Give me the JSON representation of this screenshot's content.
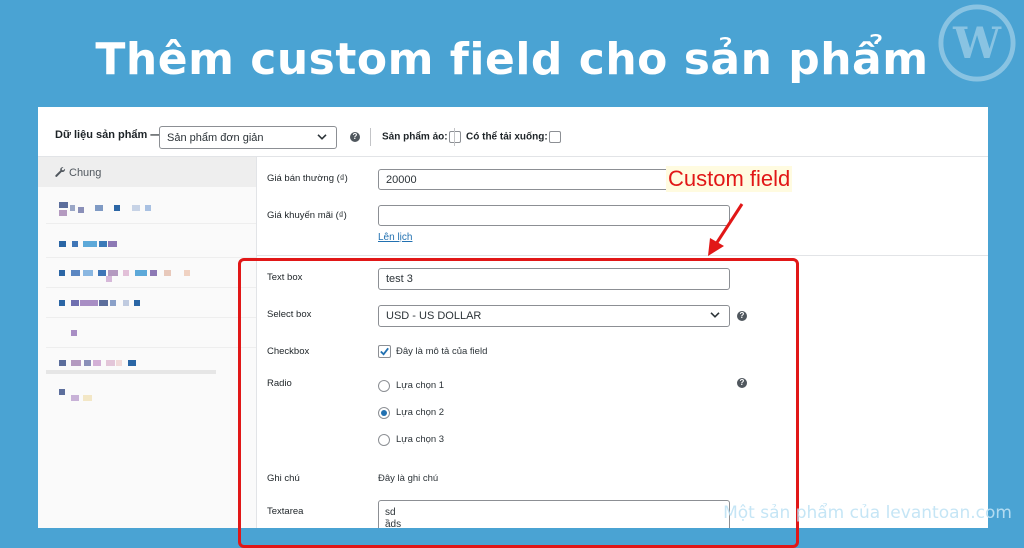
{
  "headline": "Thêm custom field cho sản phẩm",
  "brand_logo": "wordpress-logo",
  "watermark": "Một sản phẩm của levantoan.com",
  "product_data": {
    "label": "Dữ liệu sản phẩm —",
    "product_type": "Sản phẩm đơn giản",
    "virtual_label": "Sản phẩm ảo:",
    "downloadable_label": "Có thể tải xuống:"
  },
  "sidebar": {
    "first_tab": "Chung",
    "first_tab_icon": "wrench-icon"
  },
  "fields": {
    "regular_price_label": "Giá bán thường (₫)",
    "regular_price_value": "20000",
    "sale_price_label": "Giá khuyến mãi (₫)",
    "sale_price_value": "",
    "schedule_link": "Lên lịch",
    "textbox_label": "Text box",
    "textbox_value": "test 3",
    "selectbox_label": "Select box",
    "selectbox_value": "USD - US DOLLAR",
    "checkbox_label": "Checkbox",
    "checkbox_desc": "Đây là mô tả của field",
    "checkbox_checked": true,
    "radio_label": "Radio",
    "radio_options": [
      "Lựa chọn 1",
      "Lựa chọn 2",
      "Lựa chọn 3"
    ],
    "radio_selected": 1,
    "note_label": "Ghi chú",
    "note_value": "Đây là ghi chú",
    "textarea_label": "Textarea",
    "textarea_line1": "sd",
    "textarea_line2": "ầds"
  },
  "annotation": {
    "text": "Custom field",
    "color": "#e11717"
  },
  "colors": {
    "background": "#4aa3d3",
    "link": "#2271b1",
    "accent": "#2271b1"
  }
}
